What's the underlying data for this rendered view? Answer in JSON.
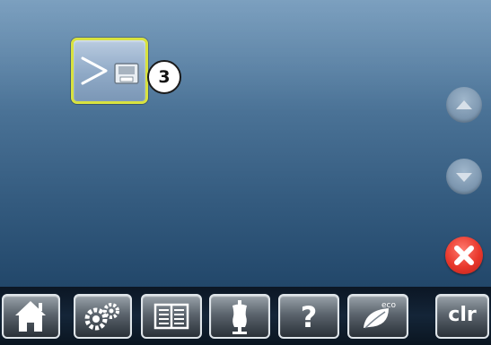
{
  "screen": {
    "stitch_display": {
      "selected_tile_icon": "stitch-to-memory-icon",
      "callout_number": "3"
    },
    "side_controls": {
      "scroll_up_icon": "chevron-up-icon",
      "scroll_down_icon": "chevron-down-icon",
      "close_icon": "close-icon"
    }
  },
  "toolbar": {
    "buttons": [
      {
        "icon": "home-icon"
      },
      {
        "icon": "setup-gears-icon"
      },
      {
        "icon": "tutorial-book-icon"
      },
      {
        "icon": "creative-consultant-dress-form-icon"
      },
      {
        "icon": "help-question-icon"
      },
      {
        "icon": "eco-leaf-icon",
        "label": "eco"
      },
      {
        "label": "clr"
      }
    ]
  },
  "colors": {
    "selection_border": "#d8e23f",
    "close_red": "#e8372b",
    "background_top": "#6d95b8",
    "background_bottom": "#22476a"
  }
}
